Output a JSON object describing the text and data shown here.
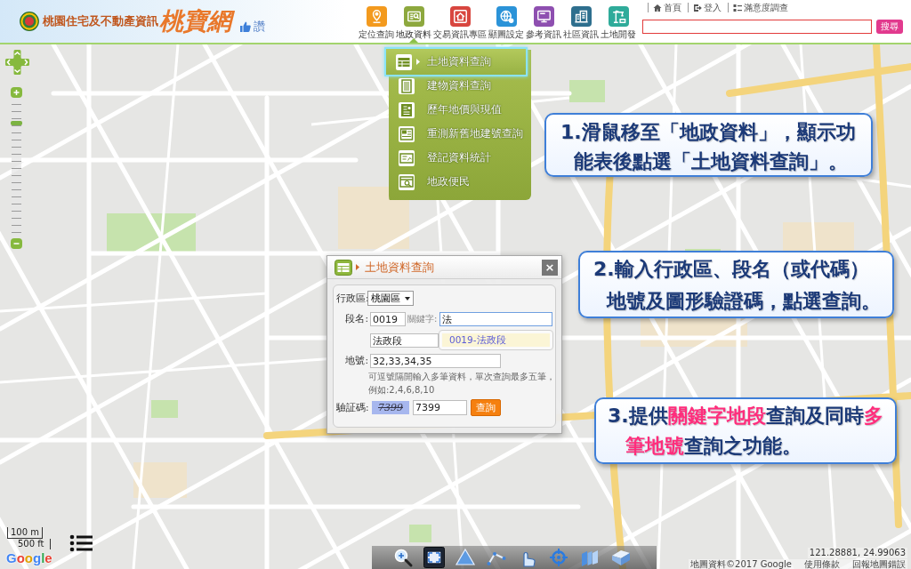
{
  "header": {
    "logo_text": "桃園住宅及不動產資訊",
    "logo_brand": "桃寶網",
    "like": "讚",
    "nav": [
      {
        "label": "定位查詢",
        "color": "#f39a1e",
        "selected": false
      },
      {
        "label": "地政資料",
        "color": "#8da83e",
        "selected": true
      },
      {
        "label": "交易資訊專區",
        "color": "#d8463f",
        "selected": false
      },
      {
        "label": "顯圖設定",
        "color": "#2b93d8",
        "selected": false
      },
      {
        "label": "參考資訊",
        "color": "#8e4fb0",
        "selected": false
      },
      {
        "label": "社區資訊",
        "color": "#2e6f8e",
        "selected": false
      },
      {
        "label": "土地開發",
        "color": "#2fab9a",
        "selected": false
      }
    ],
    "links": [
      "首頁",
      "登入",
      "滿意度調查"
    ],
    "search_button": "搜尋"
  },
  "menu": [
    {
      "label": "土地資料查詢",
      "selected": true
    },
    {
      "label": "建物資料查詢",
      "selected": false
    },
    {
      "label": "歷年地價與現值",
      "selected": false
    },
    {
      "label": "重測新舊地建號查詢",
      "selected": false
    },
    {
      "label": "登記資料統計",
      "selected": false
    },
    {
      "label": "地政便民",
      "selected": false
    }
  ],
  "map": {
    "zoom": {
      "level": 0.82
    },
    "scale": [
      "100 m",
      "500 ft"
    ],
    "logo": "Google",
    "coordinates": "121.28881, 24.99063",
    "data_credit": "地圖資料©2017 Google",
    "terms_link": "使用條款",
    "report_link": "回報地圖錯誤"
  },
  "dialog": {
    "title": "土地資料查詢",
    "close": "×",
    "district_label": "行政區:",
    "district": "桃園區",
    "section_label": "段名:",
    "section_code": "0019",
    "keyword_label": "關鍵字:",
    "keyword": "法",
    "suggestion": "0019-法政段",
    "section_name": "法政段",
    "lot_label": "地號:",
    "lot_numbers": "32,33,34,35",
    "hint": [
      "可逗號隔開輸入多筆資料，單次查詢最多五筆，",
      "例如:2,4,6,8,10"
    ],
    "captcha_label": "驗証碼:",
    "captcha": "7399",
    "captcha_input": "7399",
    "submit": "查詢"
  },
  "callouts": [
    {
      "lines": [
        "1.滑鼠移至「地政資料」，顯示功",
        "能表後點選「土地資料查詢」。"
      ]
    },
    {
      "lines": [
        "2.輸入行政區、段名（或代碼）",
        "地號及圖形驗證碼，點選查詢。"
      ]
    },
    {
      "lines": [
        "3.提供**關鍵字地段**查詢及同時**多**",
        "**筆地號**查詢之功能。"
      ]
    }
  ],
  "toolbar": [
    {
      "selected": false
    },
    {
      "selected": true
    },
    {
      "selected": false
    },
    {
      "selected": false
    },
    {
      "selected": false
    },
    {
      "selected": false
    },
    {
      "selected": false
    },
    {
      "selected": false
    }
  ]
}
